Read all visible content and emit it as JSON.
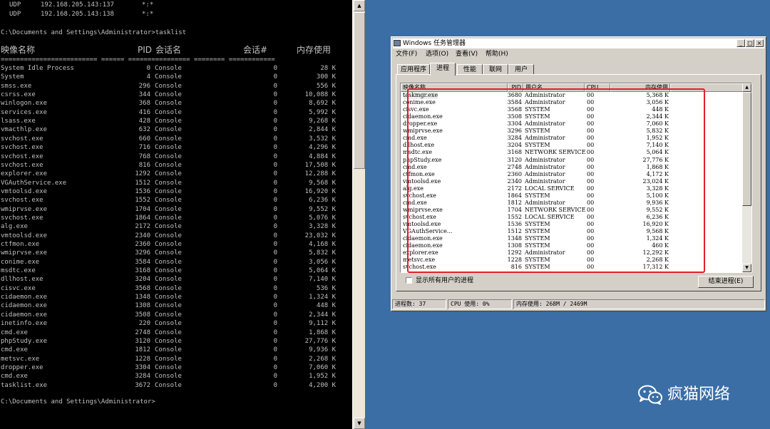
{
  "console": {
    "udp_lines": [
      [
        "UDP",
        "192.168.205.143:137",
        "*:*"
      ],
      [
        "UDP",
        "192.168.205.143:138",
        "*:*"
      ]
    ],
    "command_line": "C:\\Documents and Settings\\Administrator>tasklist",
    "headers": {
      "image_name": "映像名称",
      "pid": "PID",
      "session_name": "会话名",
      "session_num": "会话#",
      "mem_usage": "内存使用"
    },
    "separator": "========================= ====== ================ ======== ============",
    "processes": [
      [
        "System Idle Process",
        "0",
        "Console",
        "0",
        "28 K"
      ],
      [
        "System",
        "4",
        "Console",
        "0",
        "300 K"
      ],
      [
        "smss.exe",
        "296",
        "Console",
        "0",
        "556 K"
      ],
      [
        "csrss.exe",
        "344",
        "Console",
        "0",
        "10,088 K"
      ],
      [
        "winlogon.exe",
        "368",
        "Console",
        "0",
        "8,692 K"
      ],
      [
        "services.exe",
        "416",
        "Console",
        "0",
        "5,992 K"
      ],
      [
        "lsass.exe",
        "428",
        "Console",
        "0",
        "9,268 K"
      ],
      [
        "vmacthlp.exe",
        "632",
        "Console",
        "0",
        "2,844 K"
      ],
      [
        "svchost.exe",
        "660",
        "Console",
        "0",
        "3,532 K"
      ],
      [
        "svchost.exe",
        "716",
        "Console",
        "0",
        "4,296 K"
      ],
      [
        "svchost.exe",
        "768",
        "Console",
        "0",
        "4,884 K"
      ],
      [
        "svchost.exe",
        "816",
        "Console",
        "0",
        "17,508 K"
      ],
      [
        "explorer.exe",
        "1292",
        "Console",
        "0",
        "12,288 K"
      ],
      [
        "VGAuthService.exe",
        "1512",
        "Console",
        "0",
        "9,568 K"
      ],
      [
        "vmtoolsd.exe",
        "1536",
        "Console",
        "0",
        "16,920 K"
      ],
      [
        "svchost.exe",
        "1552",
        "Console",
        "0",
        "6,236 K"
      ],
      [
        "wmiprvse.exe",
        "1704",
        "Console",
        "0",
        "9,552 K"
      ],
      [
        "svchost.exe",
        "1864",
        "Console",
        "0",
        "5,076 K"
      ],
      [
        "alg.exe",
        "2172",
        "Console",
        "0",
        "3,328 K"
      ],
      [
        "vmtoolsd.exe",
        "2340",
        "Console",
        "0",
        "23,032 K"
      ],
      [
        "ctfmon.exe",
        "2360",
        "Console",
        "0",
        "4,168 K"
      ],
      [
        "wmiprvse.exe",
        "3296",
        "Console",
        "0",
        "5,832 K"
      ],
      [
        "conime.exe",
        "3584",
        "Console",
        "0",
        "3,056 K"
      ],
      [
        "msdtc.exe",
        "3168",
        "Console",
        "0",
        "5,064 K"
      ],
      [
        "dllhost.exe",
        "3204",
        "Console",
        "0",
        "7,140 K"
      ],
      [
        "cisvc.exe",
        "3568",
        "Console",
        "0",
        "536 K"
      ],
      [
        "cidaemon.exe",
        "1348",
        "Console",
        "0",
        "1,324 K"
      ],
      [
        "cidaemon.exe",
        "1308",
        "Console",
        "0",
        "448 K"
      ],
      [
        "cidaemon.exe",
        "3508",
        "Console",
        "0",
        "2,344 K"
      ],
      [
        "inetinfo.exe",
        "220",
        "Console",
        "0",
        "9,112 K"
      ],
      [
        "cmd.exe",
        "2748",
        "Console",
        "0",
        "1,868 K"
      ],
      [
        "phpStudy.exe",
        "3120",
        "Console",
        "0",
        "27,776 K"
      ],
      [
        "cmd.exe",
        "1812",
        "Console",
        "0",
        "9,936 K"
      ],
      [
        "metsvc.exe",
        "1228",
        "Console",
        "0",
        "2,268 K"
      ],
      [
        "dropper.exe",
        "3304",
        "Console",
        "0",
        "7,060 K"
      ],
      [
        "cmd.exe",
        "3284",
        "Console",
        "0",
        "1,952 K"
      ],
      [
        "tasklist.exe",
        "3672",
        "Console",
        "0",
        "4,200 K"
      ]
    ],
    "prompt": "C:\\Documents and Settings\\Administrator>"
  },
  "taskmgr": {
    "title": "Windows 任务管理器",
    "window_buttons": {
      "minimize": "_",
      "maximize": "□",
      "close": "×"
    },
    "menu": [
      "文件(F)",
      "选项(O)",
      "查看(V)",
      "帮助(H)"
    ],
    "tabs": [
      "应用程序",
      "进程",
      "性能",
      "联网",
      "用户"
    ],
    "active_tab": "进程",
    "columns": {
      "image_name": "映像名称",
      "pid": "PID",
      "user": "用户名",
      "cpu": "CPU",
      "mem": "内存使用"
    },
    "processes": [
      [
        "taskmgr.exe",
        "3680",
        "Administrator",
        "00",
        "5,368 K"
      ],
      [
        "conime.exe",
        "3584",
        "Administrator",
        "00",
        "3,056 K"
      ],
      [
        "cisvc.exe",
        "3568",
        "SYSTEM",
        "00",
        "448 K"
      ],
      [
        "cidaemon.exe",
        "3508",
        "SYSTEM",
        "00",
        "2,344 K"
      ],
      [
        "dropper.exe",
        "3304",
        "Administrator",
        "00",
        "7,060 K"
      ],
      [
        "wmiprvse.exe",
        "3296",
        "SYSTEM",
        "00",
        "5,832 K"
      ],
      [
        "cmd.exe",
        "3284",
        "Administrator",
        "00",
        "1,952 K"
      ],
      [
        "dllhost.exe",
        "3204",
        "SYSTEM",
        "00",
        "7,140 K"
      ],
      [
        "msdtc.exe",
        "3168",
        "NETWORK SERVICE",
        "00",
        "5,064 K"
      ],
      [
        "phpStudy.exe",
        "3120",
        "Administrator",
        "00",
        "27,776 K"
      ],
      [
        "cmd.exe",
        "2748",
        "Administrator",
        "00",
        "1,868 K"
      ],
      [
        "ctfmon.exe",
        "2360",
        "Administrator",
        "00",
        "4,172 K"
      ],
      [
        "vmtoolsd.exe",
        "2340",
        "Administrator",
        "00",
        "23,024 K"
      ],
      [
        "alg.exe",
        "2172",
        "LOCAL SERVICE",
        "00",
        "3,328 K"
      ],
      [
        "svchost.exe",
        "1864",
        "SYSTEM",
        "00",
        "5,100 K"
      ],
      [
        "cmd.exe",
        "1812",
        "Administrator",
        "00",
        "9,936 K"
      ],
      [
        "wmiprvse.exe",
        "1704",
        "NETWORK SERVICE",
        "00",
        "9,552 K"
      ],
      [
        "svchost.exe",
        "1552",
        "LOCAL SERVICE",
        "00",
        "6,236 K"
      ],
      [
        "vmtoolsd.exe",
        "1536",
        "SYSTEM",
        "00",
        "16,920 K"
      ],
      [
        "VGAuthService...",
        "1512",
        "SYSTEM",
        "00",
        "9,568 K"
      ],
      [
        "cidaemon.exe",
        "1348",
        "SYSTEM",
        "00",
        "1,324 K"
      ],
      [
        "cidaemon.exe",
        "1308",
        "SYSTEM",
        "00",
        "460 K"
      ],
      [
        "explorer.exe",
        "1292",
        "Administrator",
        "00",
        "12,292 K"
      ],
      [
        "metsvc.exe",
        "1228",
        "SYSTEM",
        "00",
        "2,268 K"
      ],
      [
        "svchost.exe",
        "816",
        "SYSTEM",
        "00",
        "17,312 K"
      ]
    ],
    "show_all_users": "显示所有用户的进程",
    "show_all_checked": false,
    "end_process": "结束进程(E)",
    "status": {
      "processes": "进程数: 37",
      "cpu": "CPU 使用: 0%",
      "memory": "内存使用: 268M / 2469M"
    }
  },
  "watermark": {
    "text": "疯猫网络",
    "icon": "wechat-icon"
  },
  "colors": {
    "desktop": "#3a6ea5",
    "console_bg": "#000000",
    "console_text": "#c0c0c0",
    "highlight": "#e0202a"
  }
}
